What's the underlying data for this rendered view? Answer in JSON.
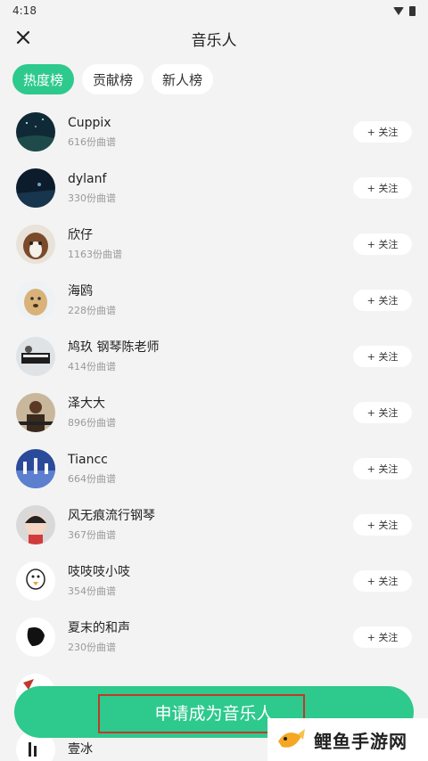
{
  "status_bar": {
    "time": "4:18"
  },
  "header": {
    "title": "音乐人"
  },
  "tabs": [
    {
      "label": "热度榜",
      "active": true
    },
    {
      "label": "贡献榜",
      "active": false
    },
    {
      "label": "新人榜",
      "active": false
    }
  ],
  "musicians": [
    {
      "name": "Cuppix",
      "count": "616份曲谱",
      "follow": "+ 关注"
    },
    {
      "name": "dylanf",
      "count": "330份曲谱",
      "follow": "+ 关注"
    },
    {
      "name": "欣仔",
      "count": "1163份曲谱",
      "follow": "+ 关注"
    },
    {
      "name": "海鸥",
      "count": "228份曲谱",
      "follow": "+ 关注"
    },
    {
      "name": "鸠玖 钢琴陈老师",
      "count": "414份曲谱",
      "follow": "+ 关注"
    },
    {
      "name": "泽大大",
      "count": "896份曲谱",
      "follow": "+ 关注"
    },
    {
      "name": "Tiancc",
      "count": "664份曲谱",
      "follow": "+ 关注"
    },
    {
      "name": "风无痕流行钢琴",
      "count": "367份曲谱",
      "follow": "+ 关注"
    },
    {
      "name": "吱吱吱小吱",
      "count": "354份曲谱",
      "follow": "+ 关注"
    },
    {
      "name": "夏末的和声",
      "count": "230份曲谱",
      "follow": "+ 关注"
    },
    {
      "name": "",
      "count": "",
      "follow": ""
    },
    {
      "name": "壹冰",
      "count": "",
      "follow": ""
    }
  ],
  "cta": {
    "label": "申请成为音乐人"
  },
  "watermark": {
    "text": "鲤鱼手游网"
  },
  "colors": {
    "accent": "#2ec98d",
    "highlight_outline": "#c0392b"
  }
}
